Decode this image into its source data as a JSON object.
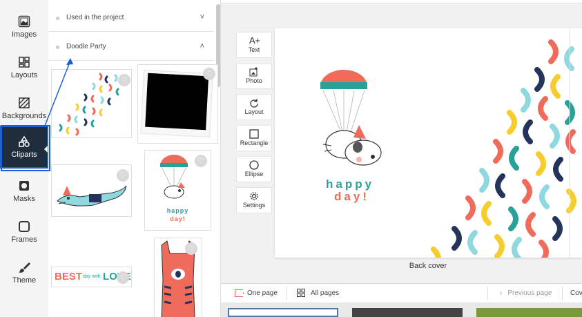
{
  "rail": {
    "items": [
      {
        "label": "Images",
        "icon": "image-icon"
      },
      {
        "label": "Layouts",
        "icon": "layout-grid-icon"
      },
      {
        "label": "Backgrounds",
        "icon": "hatch-icon"
      },
      {
        "label": "Cliparts",
        "icon": "shapes-icon"
      },
      {
        "label": "Masks",
        "icon": "mask-icon"
      },
      {
        "label": "Frames",
        "icon": "frame-icon"
      },
      {
        "label": "Theme",
        "icon": "brush-icon"
      }
    ]
  },
  "panel": {
    "sections": [
      {
        "label": "Used in the project",
        "chevron": "˅"
      },
      {
        "label": "Doodle Party",
        "chevron": "˄"
      }
    ],
    "clipart_texts": {
      "best": "BEST",
      "day_with": "day with",
      "love": "LOVE",
      "happy_small": "happy",
      "day_small": "day!"
    }
  },
  "toolbar": {
    "tools": [
      {
        "label": "Text",
        "icon": "A+"
      },
      {
        "label": "Photo",
        "icon": "photo-add-icon"
      },
      {
        "label": "Layout",
        "icon": "refresh-icon"
      },
      {
        "label": "Rectangle",
        "icon": "rectangle-icon"
      },
      {
        "label": "Ellipse",
        "icon": "ellipse-icon"
      },
      {
        "label": "Settings",
        "icon": "gear-icon"
      }
    ]
  },
  "canvas": {
    "happy": "happy",
    "day": "day!",
    "page_label": "Back cover"
  },
  "bottom": {
    "one_page": "One page",
    "all_pages": "All pages",
    "previous_page": "Previous page",
    "cover_tab": "Cov"
  },
  "colors": {
    "accent": "#1d5ed8",
    "active_bg": "#1f2d3d",
    "red": "#ef6b5b",
    "teal": "#2aa198",
    "cyan": "#8ed8e0",
    "navy": "#24345a",
    "yellow": "#f6cd2c"
  }
}
